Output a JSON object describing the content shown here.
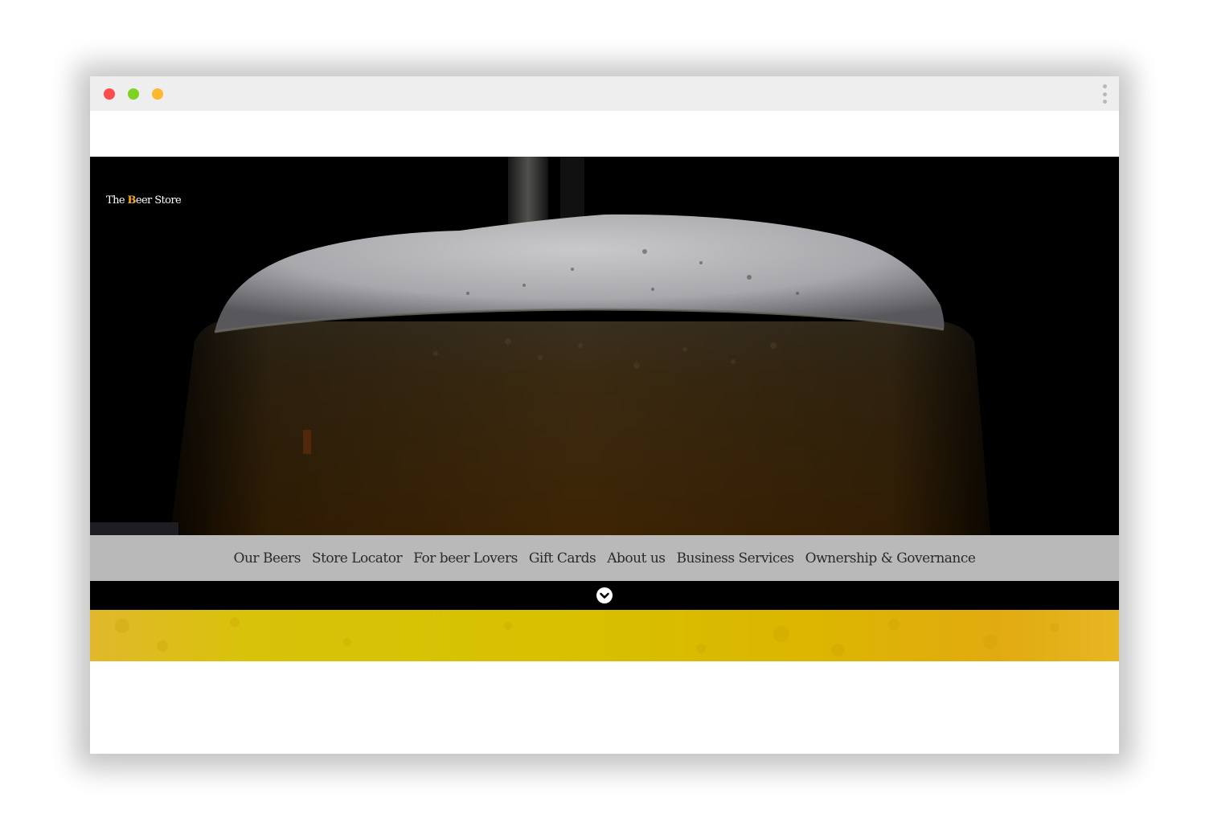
{
  "window": {
    "traffic_lights": [
      "close",
      "minimize",
      "maximize"
    ],
    "menu_icon": "kebab-menu-icon"
  },
  "hero": {
    "logo": {
      "part1": "The ",
      "highlight": "B",
      "part2": "eer Store"
    }
  },
  "nav": {
    "items": [
      {
        "label": "Our Beers"
      },
      {
        "label": "Store Locator"
      },
      {
        "label": "For beer Lovers"
      },
      {
        "label": "Gift Cards"
      },
      {
        "label": "About us"
      },
      {
        "label": "Business Services"
      },
      {
        "label": "Ownership & Governance"
      }
    ]
  },
  "scroll": {
    "icon": "chevron-down-icon"
  },
  "colors": {
    "chrome": "#eeeeee",
    "close": "#fc4c4c",
    "minimize": "#7ed321",
    "maximize": "#fdb831",
    "nav_bg": "#b9b9b9",
    "nav_text": "#2a2a2a",
    "logo_accent": "#f5a623",
    "beer_band": "#d7c100"
  }
}
